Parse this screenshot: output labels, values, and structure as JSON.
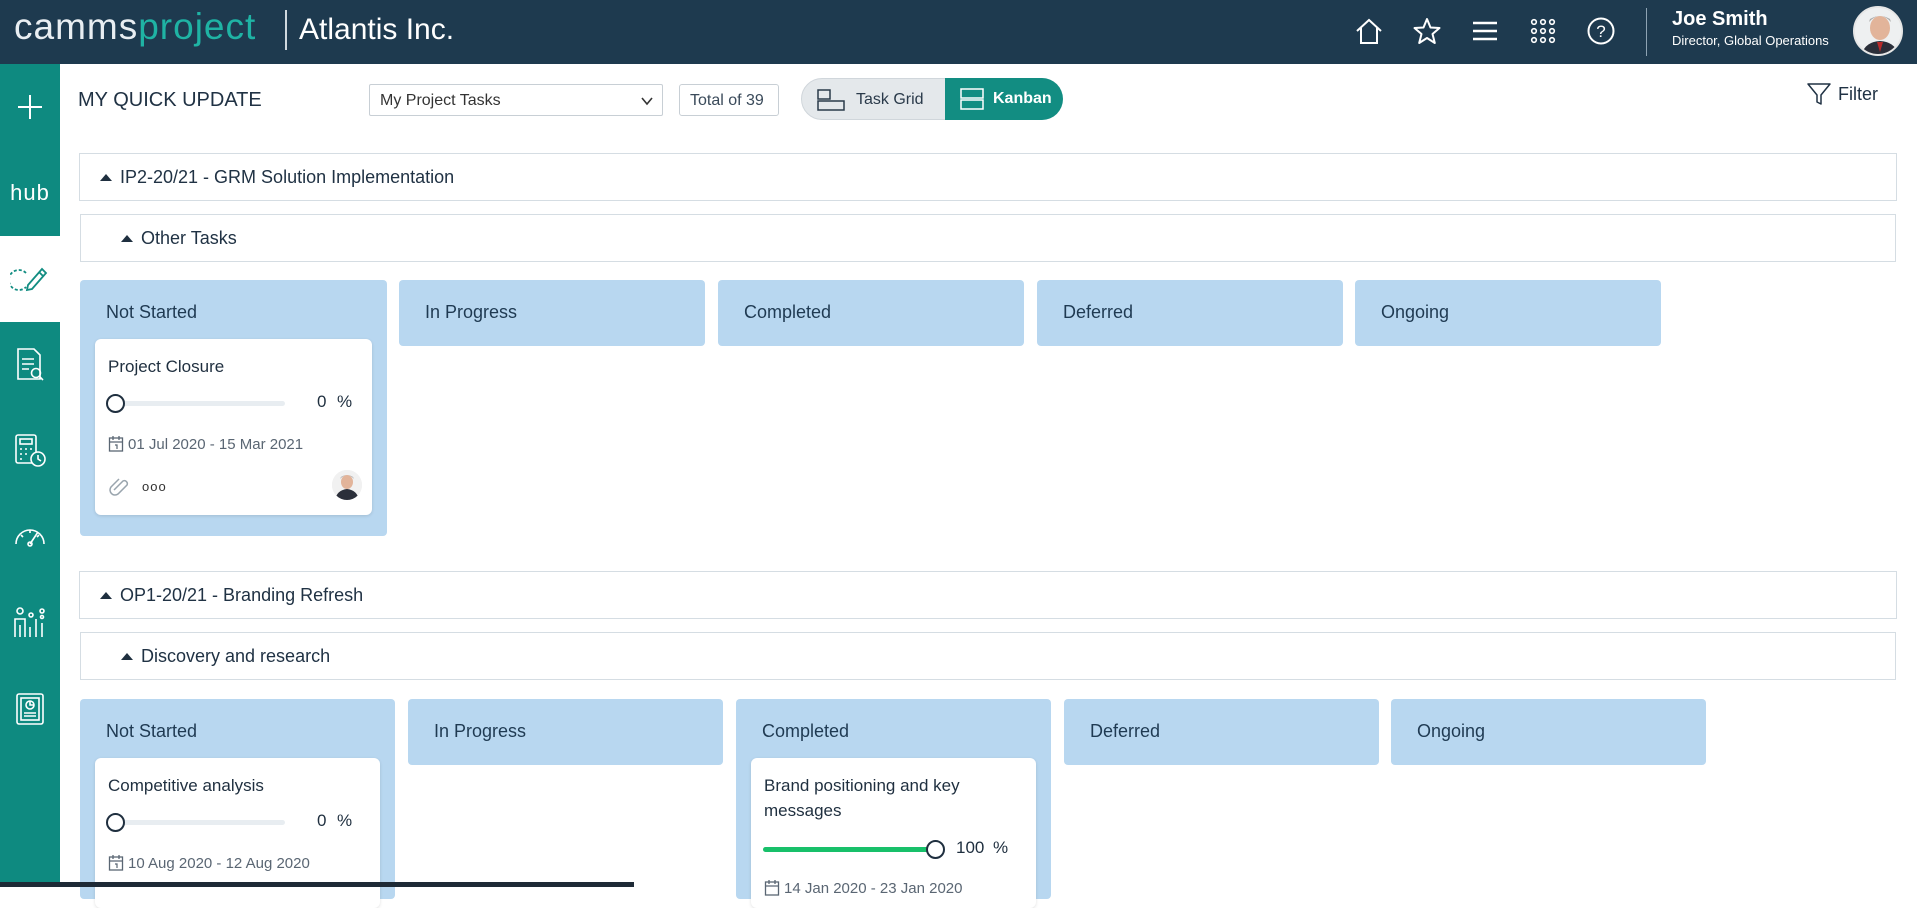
{
  "header": {
    "logo_part1": "camms",
    "logo_part2": "project",
    "company": "Atlantis Inc.",
    "icons": [
      "home-icon",
      "star-icon",
      "menu-icon",
      "apps-grid-icon",
      "help-icon"
    ],
    "user_name": "Joe Smith",
    "user_role": "Director, Global Operations"
  },
  "sidebar": {
    "items": [
      {
        "name": "add-icon"
      },
      {
        "name": "hub-logo",
        "label": "hub"
      },
      {
        "name": "quick-update-icon",
        "active": true
      },
      {
        "name": "document-search-icon"
      },
      {
        "name": "calculator-clock-icon"
      },
      {
        "name": "gauge-icon"
      },
      {
        "name": "people-chart-icon"
      },
      {
        "name": "report-icon"
      }
    ]
  },
  "toolbar": {
    "title": "MY QUICK UPDATE",
    "select_value": "My Project Tasks",
    "total": "Total of 39",
    "task_grid": "Task Grid",
    "kanban": "Kanban",
    "filter": "Filter"
  },
  "groups": [
    {
      "title": "IP2-20/21 - GRM Solution Implementation",
      "subgroup": "Other Tasks",
      "columns": [
        "Not Started",
        "In Progress",
        "Completed",
        "Deferred",
        "Ongoing"
      ],
      "cards": [
        {
          "title": "Project Closure",
          "progress": 0,
          "pct": "0",
          "pct_sign": "%",
          "dates": "01 Jul 2020 - 15 Mar 2021",
          "more": "ooo"
        }
      ]
    },
    {
      "title": "OP1-20/21 - Branding Refresh",
      "subgroup": "Discovery and research",
      "columns": [
        "Not Started",
        "In Progress",
        "Completed",
        "Deferred",
        "Ongoing"
      ],
      "cards": [
        {
          "title": "Competitive analysis",
          "progress": 0,
          "pct": "0",
          "pct_sign": "%",
          "dates": "10 Aug 2020 - 12 Aug 2020"
        },
        {
          "title": "Brand positioning and key messages",
          "progress": 100,
          "pct": "100",
          "pct_sign": "%",
          "dates": "14 Jan 2020 - 23 Jan 2020"
        }
      ]
    }
  ],
  "colors": {
    "topbar": "#1e3a4f",
    "sidebar": "#0e8a80",
    "accent": "#128d82",
    "column_bg": "#b8d7f0",
    "progress_fill": "#18c06a"
  }
}
